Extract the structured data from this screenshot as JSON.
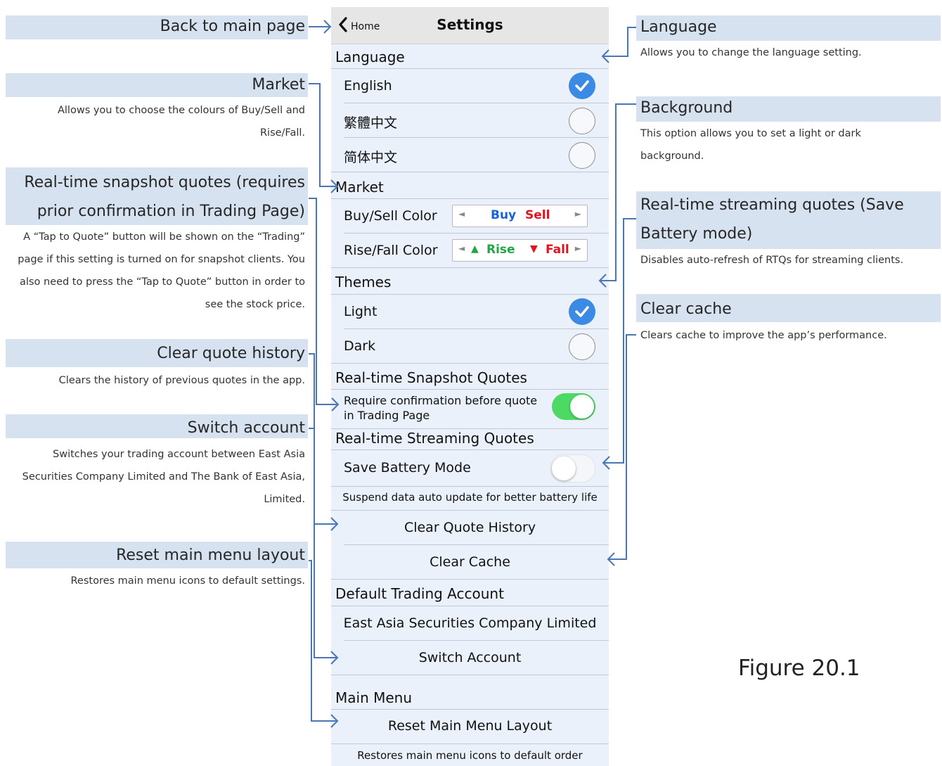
{
  "annotations": {
    "back": {
      "title": "Back to main page"
    },
    "market": {
      "title": "Market",
      "desc": "Allows you to choose the colours of Buy/Sell and Rise/Fall."
    },
    "snapshot": {
      "title_line1": "Real-time snapshot quotes (requires",
      "title_line2": "prior confirmation in Trading Page)",
      "desc": "A “Tap to Quote” button will be shown on the “Trading” page if this setting is turned on for snapshot clients. You also need to press the “Tap to Quote” button in order to see the stock price."
    },
    "clear_history": {
      "title": "Clear quote history",
      "desc": "Clears the history of previous quotes in the app."
    },
    "switch_account": {
      "title": "Switch account",
      "desc": "Switches your trading account between East Asia Securities Company Limited and The Bank of East Asia, Limited."
    },
    "reset_menu": {
      "title": "Reset main menu layout",
      "desc": "Restores main menu icons to default settings."
    },
    "language": {
      "title": "Language",
      "desc": "Allows you to change the language setting."
    },
    "background": {
      "title": "Background",
      "desc": "This option allows you to set a light or dark background."
    },
    "streaming": {
      "title_line1": "Real-time streaming quotes (Save",
      "title_line2": "Battery mode)",
      "desc": "Disables auto-refresh of RTQs for streaming clients."
    },
    "clear_cache": {
      "title": "Clear cache",
      "desc": "Clears cache to improve the app’s performance."
    }
  },
  "figure_caption": "Figure 20.1",
  "app": {
    "nav": {
      "back_label": "Home",
      "title": "Settings"
    },
    "language": {
      "header": "Language",
      "options": [
        {
          "label": "English",
          "selected": true
        },
        {
          "label": "繁體中文",
          "selected": false
        },
        {
          "label": "简体中文",
          "selected": false
        }
      ]
    },
    "market": {
      "header": "Market",
      "buysell": {
        "label": "Buy/Sell Color",
        "buy": "Buy",
        "sell": "Sell"
      },
      "risefall": {
        "label": "Rise/Fall Color",
        "rise": "Rise",
        "fall": "Fall",
        "rise_icon": "▲",
        "fall_icon": "▼"
      }
    },
    "themes": {
      "header": "Themes",
      "options": [
        {
          "label": "Light",
          "selected": true
        },
        {
          "label": "Dark",
          "selected": false
        }
      ]
    },
    "snapshot": {
      "header": "Real-time Snapshot Quotes",
      "toggle_line1": "Require confirmation before quote",
      "toggle_line2": "in Trading Page",
      "on": true
    },
    "streaming": {
      "header": "Real-time Streaming Quotes",
      "toggle_label": "Save Battery Mode",
      "on": false,
      "note": "Suspend data auto update for better battery life"
    },
    "clear_history_label": "Clear Quote History",
    "clear_cache_label": "Clear Cache",
    "account": {
      "header": "Default Trading Account",
      "name": "East Asia Securities Company Limited",
      "switch_label": "Switch Account"
    },
    "main_menu": {
      "header": "Main Menu",
      "reset_label": "Reset Main Menu Layout",
      "note": "Restores main menu icons to default order"
    }
  },
  "colors": {
    "annotation_bar": "#d6e2f0",
    "arrow": "#4a76b4",
    "check": "#3b8ae3",
    "toggle_on": "#4cd964",
    "buy": "#1a62d6",
    "sell": "#e0141e",
    "rise": "#23a445",
    "fall": "#e0141e"
  }
}
